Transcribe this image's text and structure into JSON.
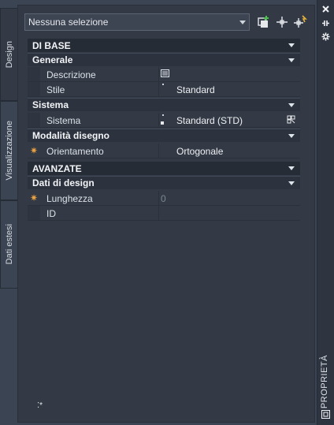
{
  "selector": {
    "value": "Nessuna selezione"
  },
  "tabs": [
    {
      "label": "Design"
    },
    {
      "label": "Visualizzazione"
    },
    {
      "label": "Dati estesi"
    }
  ],
  "palette_title": "PROPRIETÀ",
  "sections": {
    "base": "DI BASE",
    "generale": "Generale",
    "sistema": "Sistema",
    "modalita": "Modalità disegno",
    "avanzate": "AVANZATE",
    "dati_design": "Dati di design"
  },
  "rows": {
    "descrizione": {
      "label": "Descrizione",
      "value": ""
    },
    "stile": {
      "label": "Stile",
      "value": "Standard"
    },
    "sistema": {
      "label": "Sistema",
      "value": "Standard (STD)"
    },
    "orientamento": {
      "label": "Orientamento",
      "value": "Ortogonale"
    },
    "lunghezza": {
      "label": "Lunghezza",
      "value": "0"
    },
    "id": {
      "label": "ID",
      "value": ""
    }
  },
  "icons": {
    "quick_select": "quick-select-icon",
    "select_objects": "select-objects-icon",
    "toggle_pickadd": "pickadd-icon",
    "close": "close-icon",
    "autohide": "autohide-icon",
    "properties": "gear-icon"
  },
  "colors": {
    "accent_star": "#e8a040",
    "panel": "#333a45",
    "header": "#262c35"
  }
}
